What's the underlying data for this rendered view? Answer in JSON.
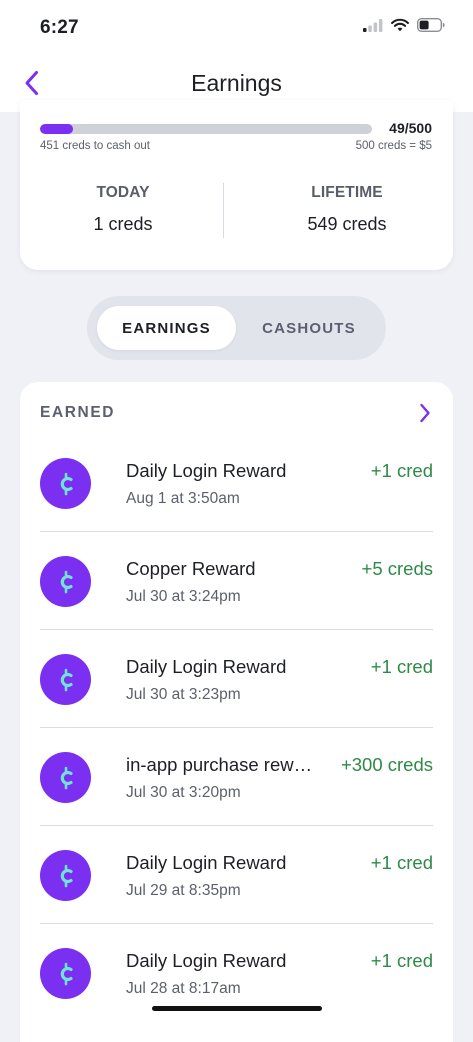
{
  "status_bar": {
    "time": "6:27"
  },
  "nav": {
    "title": "Earnings"
  },
  "progress": {
    "count": "49/500",
    "fraction": 0.098,
    "left_caption": "451 creds to cash out",
    "right_caption": "500 creds = $5"
  },
  "stats": {
    "today_label": "TODAY",
    "today_value": "1 creds",
    "lifetime_label": "LIFETIME",
    "lifetime_value": "549 creds"
  },
  "tabs": {
    "active": "EARNINGS",
    "inactive": "CASHOUTS"
  },
  "earned": {
    "header": "EARNED",
    "items": [
      {
        "title": "Daily Login Reward",
        "date": "Aug 1 at 3:50am",
        "amount": "+1 cred"
      },
      {
        "title": "Copper Reward",
        "date": "Jul 30 at 3:24pm",
        "amount": "+5 creds"
      },
      {
        "title": "Daily Login Reward",
        "date": "Jul 30 at 3:23pm",
        "amount": "+1 cred"
      },
      {
        "title": "in-app purchase rew…",
        "date": "Jul 30 at 3:20pm",
        "amount": "+300 creds"
      },
      {
        "title": "Daily Login Reward",
        "date": "Jul 29 at 8:35pm",
        "amount": "+1 cred"
      },
      {
        "title": "Daily Login Reward",
        "date": "Jul 28 at 8:17am",
        "amount": "+1 cred"
      }
    ]
  },
  "colors": {
    "accent": "#7b2ff0",
    "positive": "#2e8a46",
    "coin_symbol": "#6fe3d6"
  },
  "icons": {
    "back": "chevron-left-icon",
    "earned_more": "chevron-right-icon",
    "cred_coin": "cred-coin-icon"
  }
}
